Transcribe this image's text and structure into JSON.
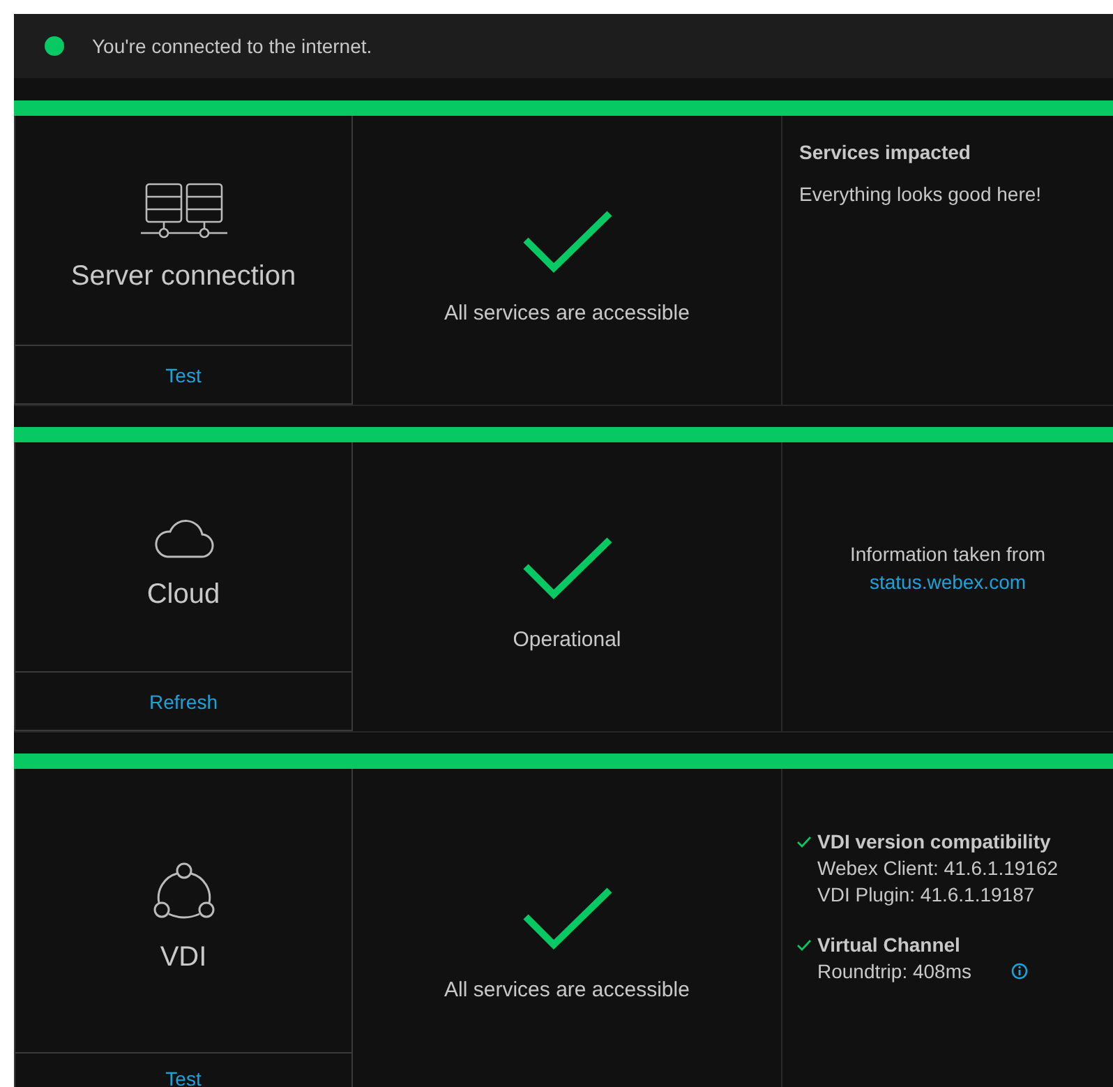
{
  "status_bar": {
    "connected": true,
    "text": "You're connected to the internet."
  },
  "sections": [
    {
      "kind": "server",
      "name": "Server connection",
      "action": "Test",
      "healthy": true,
      "result": "All services are accessible",
      "details": {
        "kind": "impacted",
        "title": "Services impacted",
        "text": "Everything looks good here!"
      }
    },
    {
      "kind": "cloud",
      "name": "Cloud",
      "action": "Refresh",
      "healthy": true,
      "result": "Operational",
      "details": {
        "kind": "source",
        "text": "Information taken from",
        "link": "status.webex.com"
      }
    },
    {
      "kind": "vdi",
      "name": "VDI",
      "action": "Test",
      "healthy": true,
      "result": "All services are accessible",
      "details": {
        "kind": "checks",
        "items": [
          {
            "passed": true,
            "title": "VDI version compatibility",
            "lines": [
              "Webex Client: 41.6.1.19162",
              "VDI Plugin: 41.6.1.19187"
            ],
            "info": false
          },
          {
            "passed": true,
            "title": "Virtual Channel",
            "lines": [
              "Roundtrip: 408ms"
            ],
            "info": true
          }
        ]
      }
    }
  ]
}
